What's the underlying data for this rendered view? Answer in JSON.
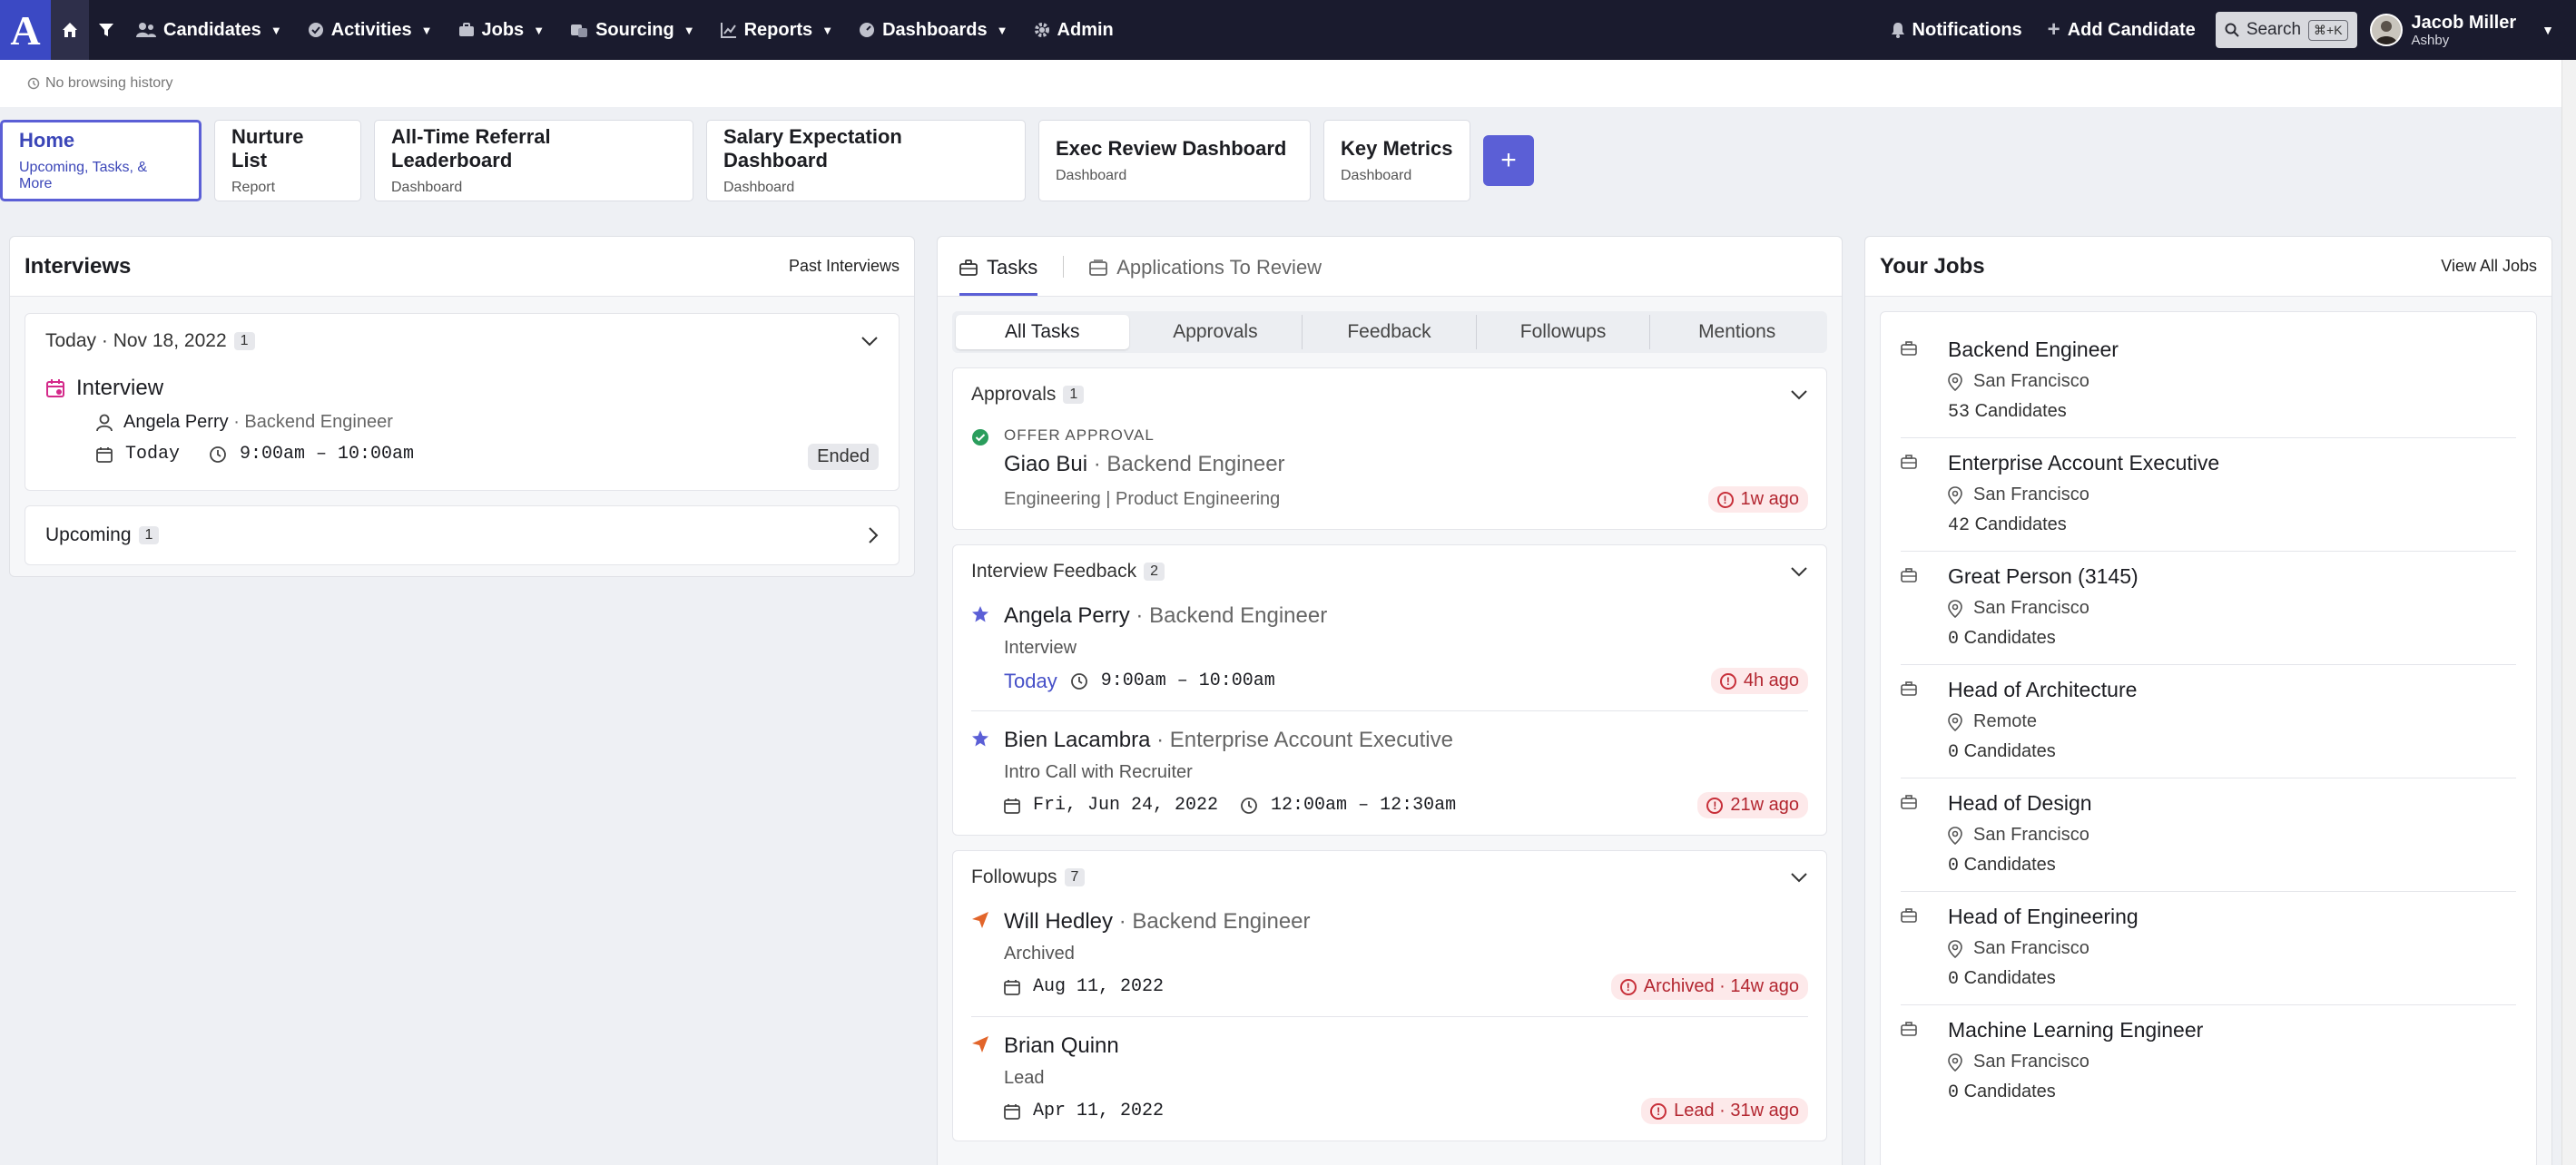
{
  "nav": {
    "logo": "A",
    "items": [
      {
        "label": "Candidates"
      },
      {
        "label": "Activities"
      },
      {
        "label": "Jobs"
      },
      {
        "label": "Sourcing"
      },
      {
        "label": "Reports"
      },
      {
        "label": "Dashboards"
      },
      {
        "label": "Admin"
      }
    ],
    "notifications": "Notifications",
    "add_candidate": "Add Candidate",
    "search": "Search",
    "search_shortcut": "⌘+K",
    "user_name": "Jacob Miller",
    "user_org": "Ashby"
  },
  "history": {
    "text": "No browsing history"
  },
  "tabs": [
    {
      "title": "Home",
      "subtitle": "Upcoming, Tasks, & More"
    },
    {
      "title": "Nurture List",
      "subtitle": "Report"
    },
    {
      "title": "All-Time Referral Leaderboard",
      "subtitle": "Dashboard"
    },
    {
      "title": "Salary Expectation Dashboard",
      "subtitle": "Dashboard"
    },
    {
      "title": "Exec Review Dashboard",
      "subtitle": "Dashboard"
    },
    {
      "title": "Key Metrics",
      "subtitle": "Dashboard"
    }
  ],
  "add_tab": "+",
  "interviews": {
    "title": "Interviews",
    "past_link": "Past Interviews",
    "today_label": "Today · Nov 18, 2022",
    "today_count": "1",
    "item": {
      "title": "Interview",
      "person": "Angela Perry",
      "role": "· Backend Engineer",
      "day": "Today",
      "time": "9:00am – 10:00am",
      "status": "Ended"
    },
    "upcoming_label": "Upcoming",
    "upcoming_count": "1"
  },
  "tasks": {
    "tab_tasks": "Tasks",
    "tab_applications": "Applications To Review",
    "filters": [
      "All Tasks",
      "Approvals",
      "Feedback",
      "Followups",
      "Mentions"
    ],
    "approvals": {
      "label": "Approvals",
      "count": "1",
      "item": {
        "kind": "OFFER APPROVAL",
        "name": "Giao Bui",
        "role": "· Backend Engineer",
        "dept": "Engineering | Product Engineering",
        "age": "1w ago"
      }
    },
    "feedback": {
      "label": "Interview Feedback",
      "count": "2",
      "items": [
        {
          "name": "Angela Perry",
          "role": "· Backend Engineer",
          "sub": "Interview",
          "day": "Today",
          "time": "9:00am – 10:00am",
          "age": "4h ago"
        },
        {
          "name": "Bien Lacambra",
          "role": "· Enterprise Account Executive",
          "sub": "Intro Call with Recruiter",
          "day": "Fri, Jun 24, 2022",
          "time": "12:00am – 12:30am",
          "age": "21w ago"
        }
      ]
    },
    "followups": {
      "label": "Followups",
      "count": "7",
      "items": [
        {
          "name": "Will Hedley",
          "role": "· Backend Engineer",
          "sub": "Archived",
          "day": "Aug 11, 2022",
          "age": "Archived · 14w ago"
        },
        {
          "name": "Brian Quinn",
          "role": "",
          "sub": "Lead",
          "day": "Apr 11, 2022",
          "age": "Lead · 31w ago"
        }
      ]
    }
  },
  "jobs": {
    "title": "Your Jobs",
    "view_all": "View All Jobs",
    "items": [
      {
        "title": "Backend Engineer",
        "location": "San Francisco",
        "count": "53",
        "suffix": "Candidates"
      },
      {
        "title": "Enterprise Account Executive",
        "location": "San Francisco",
        "count": "42",
        "suffix": "Candidates"
      },
      {
        "title": "Great Person (3145)",
        "location": "San Francisco",
        "count": "0",
        "suffix": "Candidates"
      },
      {
        "title": "Head of Architecture",
        "location": "Remote",
        "count": "0",
        "suffix": "Candidates"
      },
      {
        "title": "Head of Design",
        "location": "San Francisco",
        "count": "0",
        "suffix": "Candidates"
      },
      {
        "title": "Head of Engineering",
        "location": "San Francisco",
        "count": "0",
        "suffix": "Candidates"
      },
      {
        "title": "Machine Learning Engineer",
        "location": "San Francisco",
        "count": "0",
        "suffix": "Candidates"
      }
    ]
  },
  "colors": {
    "nav_bg": "#1a1b2e",
    "logo_bg": "#3b49c4",
    "accent": "#5b5fd6",
    "danger": "#b32630"
  }
}
